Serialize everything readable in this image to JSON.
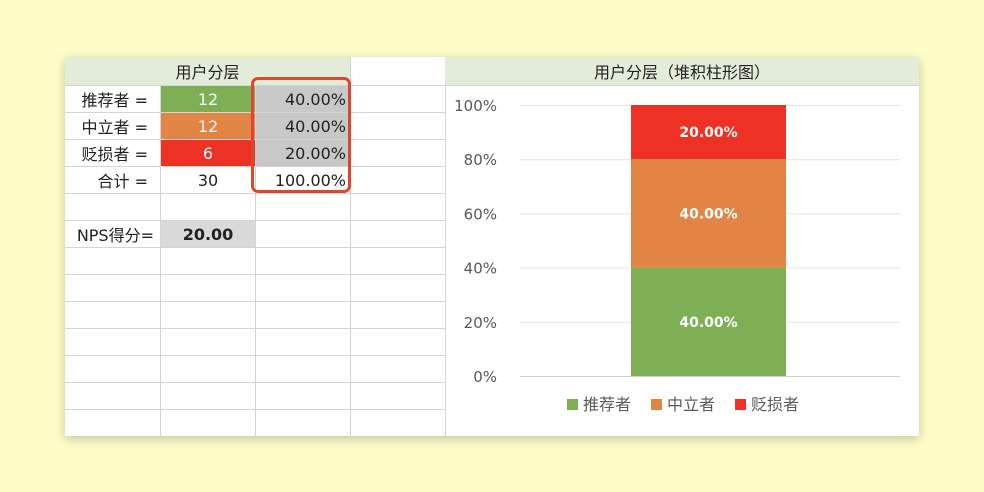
{
  "table": {
    "header": "用户分层",
    "rows": [
      {
        "label": "推荐者 =",
        "count": "12",
        "pct": "40.00%"
      },
      {
        "label": "中立者 =",
        "count": "12",
        "pct": "40.00%"
      },
      {
        "label": "贬损者 =",
        "count": "6",
        "pct": "20.00%"
      },
      {
        "label": "合计 =",
        "count": "30",
        "pct": "100.00%"
      }
    ],
    "nps_label": "NPS得分=",
    "nps_value": "20.00"
  },
  "chart_title": "用户分层（堆积柱形图）",
  "chart_data": {
    "type": "bar",
    "stacked": true,
    "categories": [
      ""
    ],
    "series": [
      {
        "name": "推荐者",
        "values": [
          40
        ],
        "label": "40.00%",
        "color": "#7faf55"
      },
      {
        "name": "中立者",
        "values": [
          40
        ],
        "label": "40.00%",
        "color": "#e28444"
      },
      {
        "name": "贬损者",
        "values": [
          20
        ],
        "label": "20.00%",
        "color": "#ee3125"
      }
    ],
    "yticks": [
      "0%",
      "20%",
      "40%",
      "60%",
      "80%",
      "100%"
    ],
    "ylim": [
      0,
      100
    ],
    "grid": true,
    "legend": "bottom"
  }
}
